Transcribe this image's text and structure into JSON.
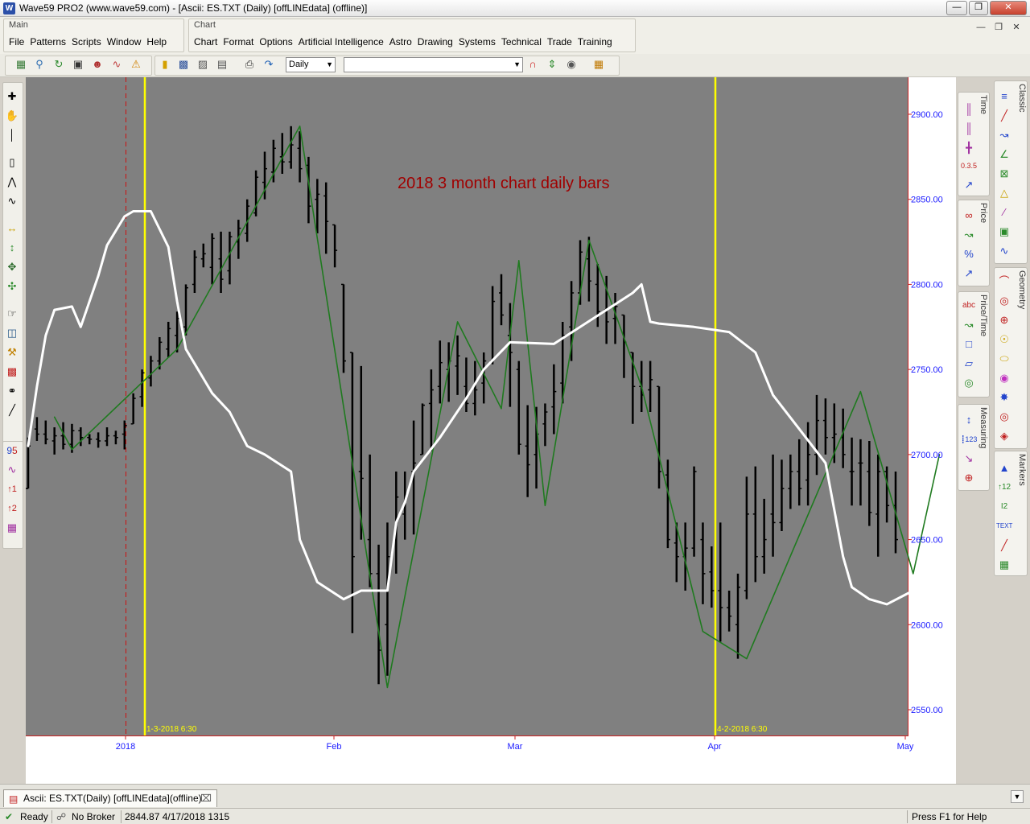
{
  "window": {
    "app_icon_letter": "W",
    "title": "Wave59 PRO2 (www.wave59.com) - [Ascii: ES.TXT (Daily) [offLINEdata] (offline)]"
  },
  "menus": {
    "main_panel_label": "Main",
    "main_items": [
      "File",
      "Patterns",
      "Scripts",
      "Window",
      "Help"
    ],
    "chart_panel_label": "Chart",
    "chart_items": [
      "Chart",
      "Format",
      "Options",
      "Artificial Intelligence",
      "Astro",
      "Drawing",
      "Systems",
      "Technical",
      "Trade",
      "Training"
    ]
  },
  "toolbar": {
    "interval_value": "Daily",
    "symbol_value": ""
  },
  "right_panels": {
    "time": "Time",
    "price": "Price",
    "price_time": "Price/Time",
    "measuring": "Measuring",
    "classic": "Classic",
    "geometry": "Geometry",
    "markers": "Markers"
  },
  "chart_data": {
    "type": "bar",
    "title": "2018 3 month chart daily bars",
    "symbol": "ES.TXT",
    "interval": "Daily",
    "y_ticks": [
      "2900.00",
      "2850.00",
      "2800.00",
      "2750.00",
      "2700.00",
      "2650.00",
      "2600.00",
      "2550.00"
    ],
    "ylim": [
      2535,
      2920
    ],
    "x_labels": [
      "2018",
      "Feb",
      "Mar",
      "Apr",
      "May"
    ],
    "vertical_markers": [
      "1-3-2018 6:30",
      "4-2-2018 6:30"
    ],
    "ohlc_bars": [
      [
        2680,
        2710,
        2683,
        2705
      ],
      [
        2715,
        2722,
        2708,
        2712
      ],
      [
        2712,
        2720,
        2706,
        2709
      ],
      [
        2708,
        2716,
        2700,
        2711
      ],
      [
        2711,
        2719,
        2703,
        2706
      ],
      [
        2706,
        2718,
        2701,
        2714
      ],
      [
        2714,
        2716,
        2705,
        2710
      ],
      [
        2710,
        2712,
        2706,
        2709
      ],
      [
        2709,
        2713,
        2704,
        2708
      ],
      [
        2708,
        2716,
        2705,
        2711
      ],
      [
        2711,
        2714,
        2706,
        2710
      ],
      [
        2712,
        2720,
        2703,
        2717
      ],
      [
        2718,
        2736,
        2718,
        2733
      ],
      [
        2734,
        2750,
        2728,
        2748
      ],
      [
        2745,
        2758,
        2740,
        2755
      ],
      [
        2755,
        2769,
        2750,
        2766
      ],
      [
        2762,
        2778,
        2757,
        2774
      ],
      [
        2770,
        2784,
        2760,
        2780
      ],
      [
        2775,
        2800,
        2770,
        2798
      ],
      [
        2800,
        2820,
        2795,
        2816
      ],
      [
        2815,
        2824,
        2810,
        2818
      ],
      [
        2810,
        2830,
        2800,
        2827
      ],
      [
        2815,
        2831,
        2795,
        2803
      ],
      [
        2808,
        2831,
        2800,
        2828
      ],
      [
        2825,
        2838,
        2815,
        2833
      ],
      [
        2830,
        2850,
        2825,
        2846
      ],
      [
        2842,
        2867,
        2840,
        2863
      ],
      [
        2860,
        2878,
        2850,
        2868
      ],
      [
        2866,
        2885,
        2860,
        2880
      ],
      [
        2875,
        2889,
        2865,
        2872
      ],
      [
        2872,
        2893,
        2868,
        2882
      ],
      [
        2880,
        2890,
        2860,
        2868
      ],
      [
        2870,
        2875,
        2836,
        2846
      ],
      [
        2850,
        2862,
        2830,
        2853
      ],
      [
        2852,
        2860,
        2818,
        2837
      ],
      [
        2835,
        2832,
        2810,
        2820
      ],
      [
        2800,
        2780,
        2748,
        2755
      ],
      [
        2760,
        2720,
        2595,
        2640
      ],
      [
        2690,
        2752,
        2650,
        2686
      ],
      [
        2650,
        2700,
        2622,
        2630
      ],
      [
        2630,
        2647,
        2565,
        2585
      ],
      [
        2600,
        2660,
        2570,
        2640
      ],
      [
        2650,
        2690,
        2630,
        2675
      ],
      [
        2665,
        2690,
        2650,
        2675
      ],
      [
        2690,
        2720,
        2653,
        2695
      ],
      [
        2700,
        2730,
        2700,
        2729
      ],
      [
        2730,
        2750,
        2702,
        2738
      ],
      [
        2740,
        2767,
        2730,
        2754
      ],
      [
        2750,
        2766,
        2731,
        2755
      ],
      [
        2752,
        2770,
        2735,
        2758
      ],
      [
        2740,
        2757,
        2725,
        2730
      ],
      [
        2730,
        2755,
        2723,
        2738
      ],
      [
        2742,
        2760,
        2730,
        2755
      ],
      [
        2755,
        2799,
        2753,
        2790
      ],
      [
        2795,
        2806,
        2776,
        2782
      ],
      [
        2770,
        2789,
        2728,
        2760
      ],
      [
        2750,
        2755,
        2700,
        2706
      ],
      [
        2705,
        2729,
        2675,
        2694
      ],
      [
        2700,
        2728,
        2680,
        2712
      ],
      [
        2718,
        2730,
        2705,
        2725
      ],
      [
        2728,
        2753,
        2712,
        2737
      ],
      [
        2742,
        2778,
        2730,
        2770
      ],
      [
        2775,
        2802,
        2755,
        2795
      ],
      [
        2795,
        2826,
        2788,
        2819
      ],
      [
        2815,
        2828,
        2790,
        2802
      ],
      [
        2800,
        2812,
        2775,
        2784
      ],
      [
        2785,
        2805,
        2765,
        2778
      ],
      [
        2780,
        2795,
        2765,
        2787
      ],
      [
        2782,
        2780,
        2745,
        2766
      ],
      [
        2760,
        2760,
        2718,
        2740
      ],
      [
        2740,
        2755,
        2725,
        2735
      ],
      [
        2738,
        2755,
        2725,
        2744
      ],
      [
        2740,
        2737,
        2680,
        2690
      ],
      [
        2688,
        2697,
        2645,
        2650
      ],
      [
        2648,
        2660,
        2625,
        2640
      ],
      [
        2640,
        2660,
        2620,
        2645
      ],
      [
        2645,
        2693,
        2640,
        2690
      ],
      [
        2650,
        2660,
        2612,
        2630
      ],
      [
        2631,
        2646,
        2610,
        2620
      ],
      [
        2620,
        2660,
        2590,
        2610
      ],
      [
        2610,
        2620,
        2596,
        2605
      ],
      [
        2600,
        2630,
        2580,
        2622
      ],
      [
        2620,
        2687,
        2615,
        2665
      ],
      [
        2665,
        2693,
        2625,
        2640
      ],
      [
        2640,
        2674,
        2630,
        2650
      ],
      [
        2665,
        2700,
        2640,
        2660
      ],
      [
        2660,
        2697,
        2655,
        2680
      ],
      [
        2680,
        2700,
        2668,
        2690
      ],
      [
        2690,
        2709,
        2670,
        2680
      ],
      [
        2685,
        2719,
        2670,
        2700
      ],
      [
        2700,
        2735,
        2688,
        2720
      ],
      [
        2720,
        2733,
        2700,
        2710
      ],
      [
        2710,
        2730,
        2695,
        2712
      ],
      [
        2710,
        2727,
        2692,
        2700
      ],
      [
        2690,
        2710,
        2670,
        2690
      ],
      [
        2695,
        2709,
        2670,
        2695
      ],
      [
        2690,
        2708,
        2658,
        2666
      ],
      [
        2665,
        2700,
        2640,
        2690
      ],
      [
        2690,
        2693,
        2660,
        2670
      ],
      [
        2670,
        2690,
        2642,
        2650
      ]
    ],
    "overlays": [
      {
        "kind": "swing-line",
        "color": "#1f7a1f",
        "points": [
          [
            3,
            2722
          ],
          [
            5,
            2703
          ],
          [
            17,
            2762
          ],
          [
            31,
            2893
          ],
          [
            41,
            2563
          ],
          [
            49,
            2778
          ],
          [
            54,
            2727
          ],
          [
            56,
            2814
          ],
          [
            59,
            2670
          ],
          [
            64,
            2826
          ],
          [
            70,
            2740
          ],
          [
            77,
            2596
          ],
          [
            82,
            2580
          ],
          [
            95,
            2737
          ],
          [
            101,
            2630
          ],
          [
            104,
            2700
          ]
        ]
      },
      {
        "kind": "smooth-line",
        "color": "#ffffff",
        "points": [
          [
            0,
            2705
          ],
          [
            1,
            2740
          ],
          [
            2,
            2770
          ],
          [
            3,
            2785
          ],
          [
            5,
            2787
          ],
          [
            6,
            2775
          ],
          [
            8,
            2805
          ],
          [
            9,
            2823
          ],
          [
            11,
            2840
          ],
          [
            12,
            2843
          ],
          [
            14,
            2843
          ],
          [
            16,
            2822
          ],
          [
            17,
            2790
          ],
          [
            18,
            2762
          ],
          [
            21,
            2736
          ],
          [
            23,
            2725
          ],
          [
            25,
            2705
          ],
          [
            27,
            2700
          ],
          [
            30,
            2690
          ],
          [
            31,
            2650
          ],
          [
            33,
            2625
          ],
          [
            36,
            2615
          ],
          [
            38,
            2620
          ],
          [
            41,
            2620
          ],
          [
            42,
            2660
          ],
          [
            43,
            2672
          ],
          [
            44,
            2690
          ],
          [
            47,
            2710
          ],
          [
            50,
            2733
          ],
          [
            52,
            2750
          ],
          [
            55,
            2766
          ],
          [
            60,
            2765
          ],
          [
            63,
            2775
          ],
          [
            66,
            2785
          ],
          [
            69,
            2795
          ],
          [
            70,
            2800
          ],
          [
            71,
            2778
          ],
          [
            72,
            2777
          ],
          [
            76,
            2775
          ],
          [
            80,
            2772
          ],
          [
            83,
            2760
          ],
          [
            85,
            2735
          ],
          [
            88,
            2715
          ],
          [
            91,
            2695
          ],
          [
            93,
            2640
          ],
          [
            94,
            2622
          ],
          [
            96,
            2615
          ],
          [
            98,
            2612
          ],
          [
            101,
            2620
          ],
          [
            103,
            2648
          ],
          [
            105,
            2672
          ]
        ]
      }
    ]
  },
  "tab": {
    "label": "Ascii: ES.TXT(Daily) [offLINEdata](offline)"
  },
  "status": {
    "ready": "Ready",
    "broker": "No Broker",
    "readout": "2844.87  4/17/2018  1315",
    "help": "Press F1 for Help"
  }
}
